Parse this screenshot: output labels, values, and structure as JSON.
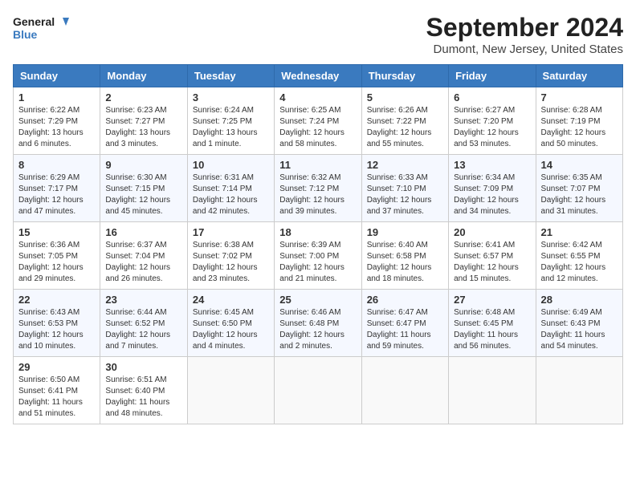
{
  "header": {
    "logo_line1": "General",
    "logo_line2": "Blue",
    "month": "September 2024",
    "location": "Dumont, New Jersey, United States"
  },
  "days_of_week": [
    "Sunday",
    "Monday",
    "Tuesday",
    "Wednesday",
    "Thursday",
    "Friday",
    "Saturday"
  ],
  "weeks": [
    [
      {
        "day": 1,
        "sunrise": "6:22 AM",
        "sunset": "7:29 PM",
        "daylight": "13 hours and 6 minutes."
      },
      {
        "day": 2,
        "sunrise": "6:23 AM",
        "sunset": "7:27 PM",
        "daylight": "13 hours and 3 minutes."
      },
      {
        "day": 3,
        "sunrise": "6:24 AM",
        "sunset": "7:25 PM",
        "daylight": "13 hours and 1 minute."
      },
      {
        "day": 4,
        "sunrise": "6:25 AM",
        "sunset": "7:24 PM",
        "daylight": "12 hours and 58 minutes."
      },
      {
        "day": 5,
        "sunrise": "6:26 AM",
        "sunset": "7:22 PM",
        "daylight": "12 hours and 55 minutes."
      },
      {
        "day": 6,
        "sunrise": "6:27 AM",
        "sunset": "7:20 PM",
        "daylight": "12 hours and 53 minutes."
      },
      {
        "day": 7,
        "sunrise": "6:28 AM",
        "sunset": "7:19 PM",
        "daylight": "12 hours and 50 minutes."
      }
    ],
    [
      {
        "day": 8,
        "sunrise": "6:29 AM",
        "sunset": "7:17 PM",
        "daylight": "12 hours and 47 minutes."
      },
      {
        "day": 9,
        "sunrise": "6:30 AM",
        "sunset": "7:15 PM",
        "daylight": "12 hours and 45 minutes."
      },
      {
        "day": 10,
        "sunrise": "6:31 AM",
        "sunset": "7:14 PM",
        "daylight": "12 hours and 42 minutes."
      },
      {
        "day": 11,
        "sunrise": "6:32 AM",
        "sunset": "7:12 PM",
        "daylight": "12 hours and 39 minutes."
      },
      {
        "day": 12,
        "sunrise": "6:33 AM",
        "sunset": "7:10 PM",
        "daylight": "12 hours and 37 minutes."
      },
      {
        "day": 13,
        "sunrise": "6:34 AM",
        "sunset": "7:09 PM",
        "daylight": "12 hours and 34 minutes."
      },
      {
        "day": 14,
        "sunrise": "6:35 AM",
        "sunset": "7:07 PM",
        "daylight": "12 hours and 31 minutes."
      }
    ],
    [
      {
        "day": 15,
        "sunrise": "6:36 AM",
        "sunset": "7:05 PM",
        "daylight": "12 hours and 29 minutes."
      },
      {
        "day": 16,
        "sunrise": "6:37 AM",
        "sunset": "7:04 PM",
        "daylight": "12 hours and 26 minutes."
      },
      {
        "day": 17,
        "sunrise": "6:38 AM",
        "sunset": "7:02 PM",
        "daylight": "12 hours and 23 minutes."
      },
      {
        "day": 18,
        "sunrise": "6:39 AM",
        "sunset": "7:00 PM",
        "daylight": "12 hours and 21 minutes."
      },
      {
        "day": 19,
        "sunrise": "6:40 AM",
        "sunset": "6:58 PM",
        "daylight": "12 hours and 18 minutes."
      },
      {
        "day": 20,
        "sunrise": "6:41 AM",
        "sunset": "6:57 PM",
        "daylight": "12 hours and 15 minutes."
      },
      {
        "day": 21,
        "sunrise": "6:42 AM",
        "sunset": "6:55 PM",
        "daylight": "12 hours and 12 minutes."
      }
    ],
    [
      {
        "day": 22,
        "sunrise": "6:43 AM",
        "sunset": "6:53 PM",
        "daylight": "12 hours and 10 minutes."
      },
      {
        "day": 23,
        "sunrise": "6:44 AM",
        "sunset": "6:52 PM",
        "daylight": "12 hours and 7 minutes."
      },
      {
        "day": 24,
        "sunrise": "6:45 AM",
        "sunset": "6:50 PM",
        "daylight": "12 hours and 4 minutes."
      },
      {
        "day": 25,
        "sunrise": "6:46 AM",
        "sunset": "6:48 PM",
        "daylight": "12 hours and 2 minutes."
      },
      {
        "day": 26,
        "sunrise": "6:47 AM",
        "sunset": "6:47 PM",
        "daylight": "11 hours and 59 minutes."
      },
      {
        "day": 27,
        "sunrise": "6:48 AM",
        "sunset": "6:45 PM",
        "daylight": "11 hours and 56 minutes."
      },
      {
        "day": 28,
        "sunrise": "6:49 AM",
        "sunset": "6:43 PM",
        "daylight": "11 hours and 54 minutes."
      }
    ],
    [
      {
        "day": 29,
        "sunrise": "6:50 AM",
        "sunset": "6:41 PM",
        "daylight": "11 hours and 51 minutes."
      },
      {
        "day": 30,
        "sunrise": "6:51 AM",
        "sunset": "6:40 PM",
        "daylight": "11 hours and 48 minutes."
      },
      null,
      null,
      null,
      null,
      null
    ]
  ]
}
